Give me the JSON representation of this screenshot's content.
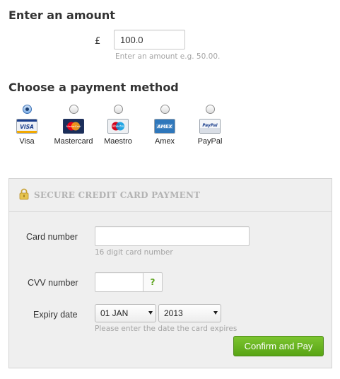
{
  "amount": {
    "heading": "Enter an amount",
    "currency_symbol": "£",
    "value": "100.0",
    "hint": "Enter an amount e.g. 50.00."
  },
  "payment_method": {
    "heading": "Choose a payment method",
    "options": [
      {
        "label": "Visa",
        "logo_text": "VISA",
        "icon": "visa-icon",
        "selected": true
      },
      {
        "label": "Mastercard",
        "logo_text": "MasterCard",
        "icon": "mastercard-icon",
        "selected": false
      },
      {
        "label": "Maestro",
        "logo_text": "Maestro",
        "icon": "maestro-icon",
        "selected": false
      },
      {
        "label": "Amex",
        "logo_text": "AMEX",
        "icon": "amex-icon",
        "selected": false
      },
      {
        "label": "PayPal",
        "logo_text": "PayPal",
        "icon": "paypal-icon",
        "selected": false
      }
    ]
  },
  "secure_payment": {
    "title": "SECURE CREDIT CARD PAYMENT",
    "card_number": {
      "label": "Card number",
      "value": "",
      "hint": "16 digit card number"
    },
    "cvv": {
      "label": "CVV number",
      "value": "",
      "help_label": "?"
    },
    "expiry": {
      "label": "Expiry date",
      "month": "01 JAN",
      "year": "2013",
      "hint": "Please enter the date the card expires"
    },
    "confirm_label": "Confirm and Pay"
  },
  "colors": {
    "confirm_green": "#6bb522",
    "radio_selected_blue": "#3a6fb4",
    "panel_background": "#efefef",
    "hint_gray": "#a4a4a4"
  }
}
